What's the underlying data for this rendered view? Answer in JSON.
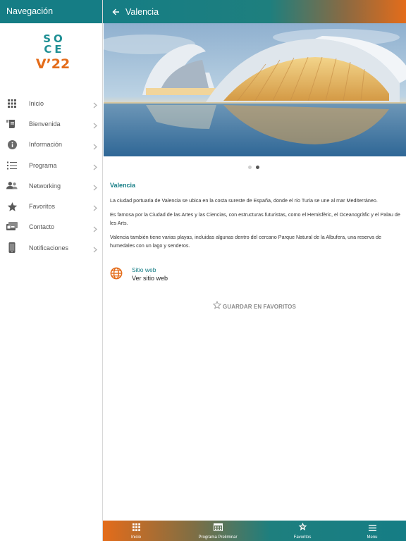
{
  "sidebar": {
    "header_title": "Navegación",
    "logo": {
      "line1": "SO",
      "line2": "CE",
      "line3": "V’22"
    },
    "items": [
      {
        "label": "Inicio",
        "icon": "grid-icon"
      },
      {
        "label": "Bienvenida",
        "icon": "scroll-icon"
      },
      {
        "label": "Información",
        "icon": "info-icon"
      },
      {
        "label": "Programa",
        "icon": "list-icon"
      },
      {
        "label": "Networking",
        "icon": "people-icon"
      },
      {
        "label": "Favoritos",
        "icon": "star-icon"
      },
      {
        "label": "Contacto",
        "icon": "contact-card-icon"
      },
      {
        "label": "Notificaciones",
        "icon": "phone-icon"
      }
    ]
  },
  "header": {
    "title": "Valencia",
    "back_icon": "back-arrow-icon"
  },
  "carousel": {
    "slides": 2,
    "active_index": 1
  },
  "content": {
    "title": "Valencia",
    "paragraphs": [
      "La ciudad portuaria de Valencia se ubica en la costa sureste de España, donde el río Turia se une al mar Mediterráneo.",
      "Es famosa por la Ciudad de las Artes y las Ciencias, con estructuras futuristas, como el Hemisfèric, el Oceanogràfic y el Palau de les Arts.",
      "Valencia también tiene varias playas, incluidas algunas dentro del cercano Parque Natural de la Albufera, una reserva de humedales con un lago y senderos."
    ],
    "website_label": "Sitio web",
    "website_link": "Ver sitio web",
    "favorite_button": "GUARDAR EN FAVORITOS"
  },
  "tabbar": {
    "tabs": [
      {
        "label": "Inicio",
        "icon": "grid-icon"
      },
      {
        "label": "Programa Preliminar",
        "icon": "calendar-icon"
      },
      {
        "label": "Favoritos",
        "icon": "star-icon"
      },
      {
        "label": "Menu",
        "icon": "hamburger-icon"
      }
    ]
  },
  "colors": {
    "teal": "#157d85",
    "orange": "#e46c1a"
  }
}
